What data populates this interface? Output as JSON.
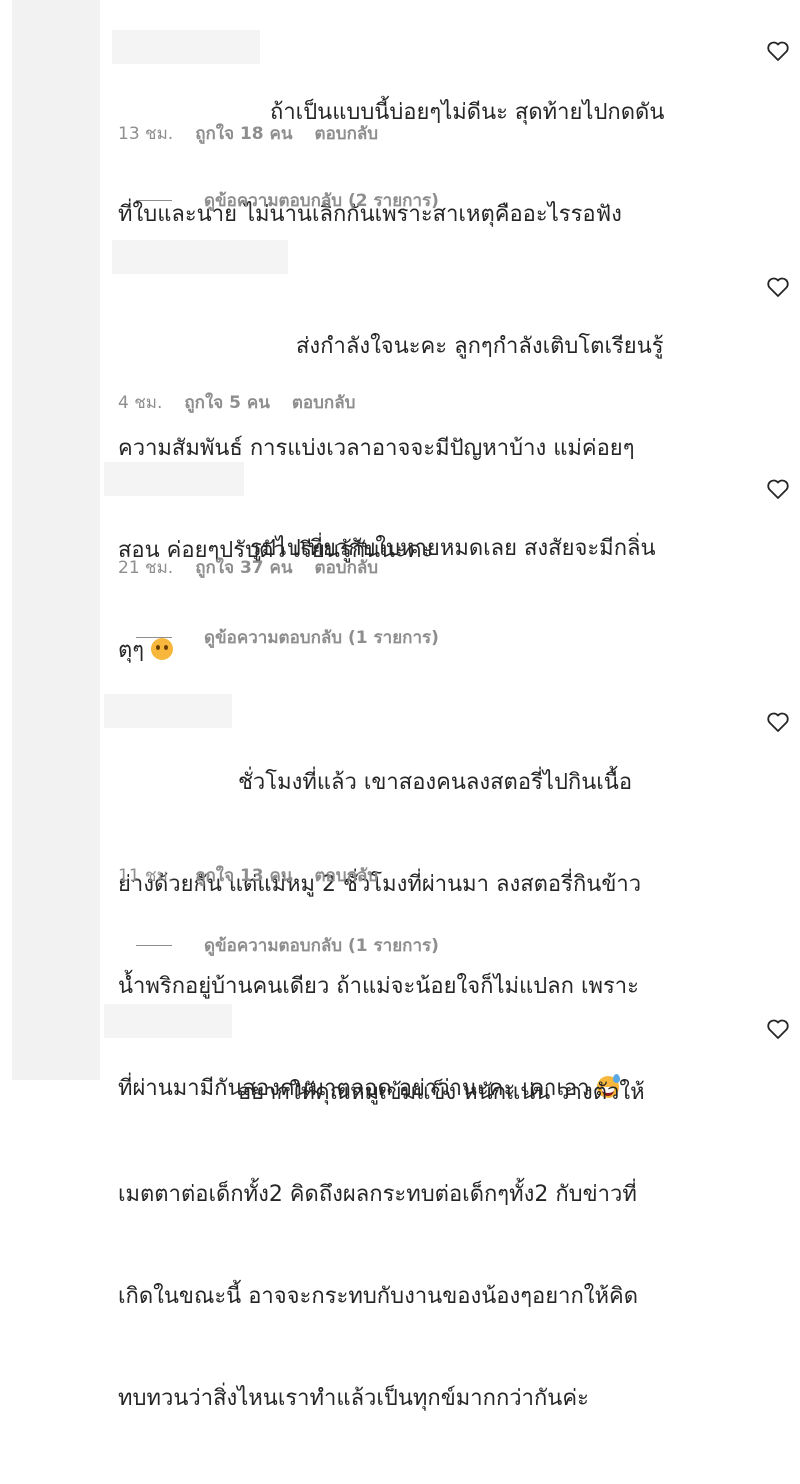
{
  "comments": [
    {
      "text_lines": [
        "ถ้าเป็นแบบนี้บ่อยๆไม่ดีนะ สุดท้ายไปกดดัน",
        "ที่ใบและนาย ไม่นานเลิกกันเพราะสาเหตุคืออะไรรอฟัง"
      ],
      "time": "13 ชม.",
      "likes": "ถูกใจ 18 คน",
      "reply": "ตอบกลับ",
      "view_replies": "ดูข้อความตอบกลับ (2 รายการ)"
    },
    {
      "text_lines": [
        "ส่งกำลังใจนะคะ ลูกๆกำลังเติบโตเรียนรู้",
        "ความสัมพันธ์ การแบ่งเวลาอาจจะมีปัญหาบ้าง แม่ค่อยๆ",
        "สอน ค่อยๆปรับตัว เรียนรู้กันนะคะ"
      ],
      "time": "4 ชม.",
      "likes": "ถูกใจ 5 คน",
      "reply": "ตอบกลับ"
    },
    {
      "text_lines": [
        "รูปไปเที่ยวกับใบหายหมดเลย สงสัยจะมีกลิ่น",
        "ตุๆ"
      ],
      "emoji": "sad-face-emoji",
      "time": "21 ชม.",
      "likes": "ถูกใจ 37 คน",
      "reply": "ตอบกลับ",
      "view_replies": "ดูข้อความตอบกลับ (1 รายการ)"
    },
    {
      "text_lines": [
        "ชั่วโมงที่แล้ว เขาสองคนลงสตอรี่ไปกินเนื้อ",
        "ย่างด้วยกัน แต่แม่หมู 2 ชั่วโมงที่ผ่านมา ลงสตอรี่กินข้าว",
        "น้ำพริกอยู่บ้านคนเดียว ถ้าแม่จะน้อยใจก็ไม่แปลก เพราะ",
        "ที่ผ่านมามีกันสองคนมาตลอด อย่าว่านะคะ เดาเอา"
      ],
      "emoji": "sweat-smile-emoji",
      "time": "11 ชม.",
      "likes": "ถูกใจ 13 คน",
      "reply": "ตอบกลับ",
      "view_replies": "ดูข้อความตอบกลับ (1 รายการ)"
    },
    {
      "text_lines": [
        "อยากให้คุณหมูเข้มแข็ง หนักแน่น วางตัวให้",
        "เมตตาต่อเด็กทั้ง2 คิดถึงผลกระทบต่อเด็กๆทั้ง2 กับข่าวที่",
        "เกิดในขณะนี้ อาจจะกระทบกับงานของน้องๆอยากให้คิด",
        "ทบทวนว่าสิ่งไหนเราทำแล้วเป็นทุกข์มากกว่ากันค่ะ"
      ]
    }
  ]
}
